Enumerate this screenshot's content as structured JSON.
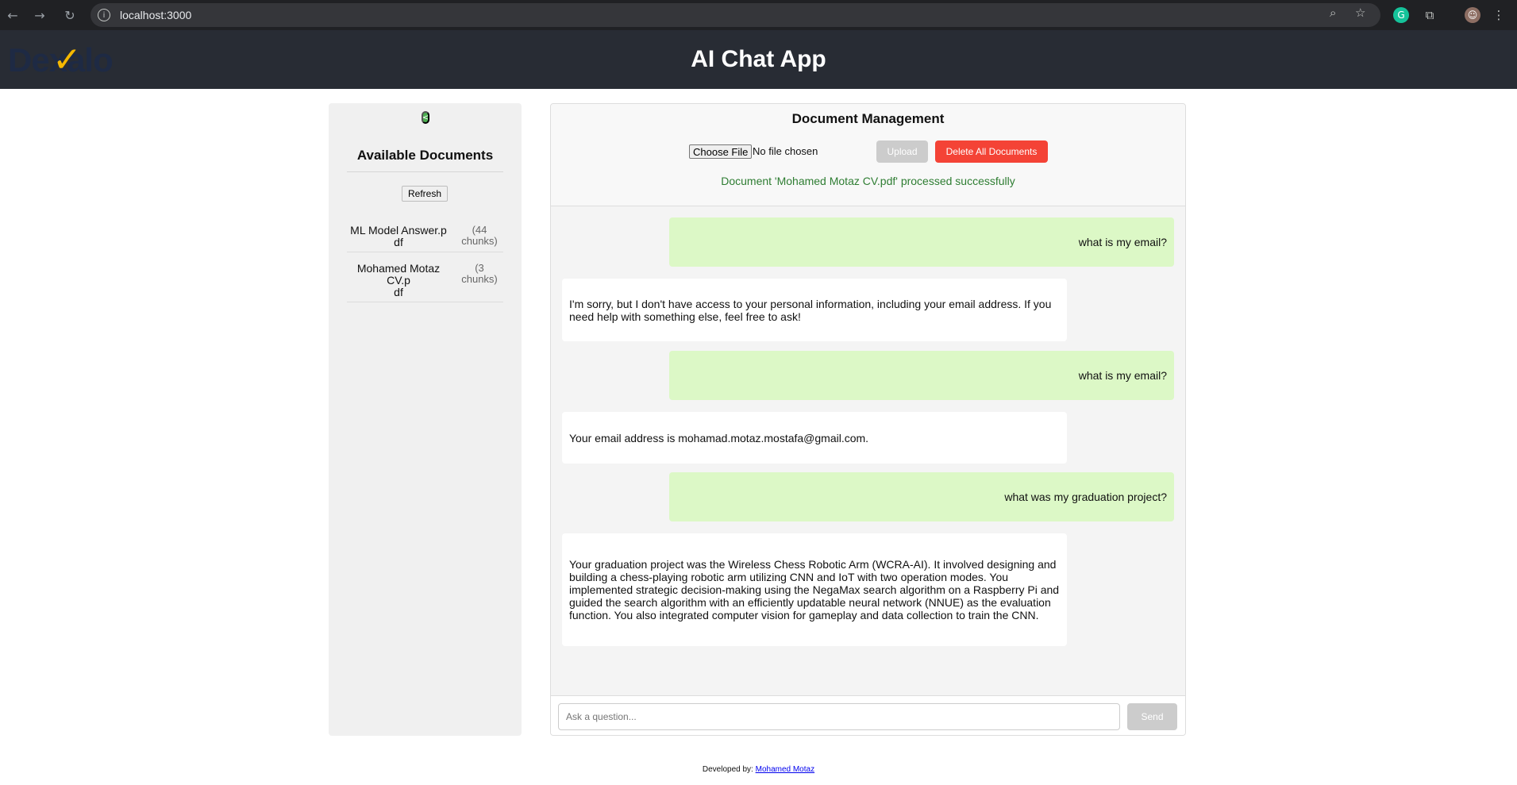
{
  "browser": {
    "url": "localhost:3000",
    "back_icon": "arrow-left-icon",
    "forward_icon": "arrow-right-icon",
    "reload_icon": "reload-icon"
  },
  "header": {
    "logo_text": "Dexalo",
    "title": "AI Chat App"
  },
  "sidebar": {
    "collapse_label": "<",
    "title": "Available Documents",
    "refresh_label": "Refresh",
    "documents": [
      {
        "name": "ML Model Answer.pdf",
        "name_line1": "ML Model Answer.p",
        "name_line2": "df",
        "chunks_line1": "(44",
        "chunks_line2": "chunks)"
      },
      {
        "name": "Mohamed Motaz CV.pdf",
        "name_line1": "Mohamed Motaz CV.p",
        "name_line2": "df",
        "chunks_line1": "(3",
        "chunks_line2": "chunks)"
      }
    ]
  },
  "doc_management": {
    "title": "Document Management",
    "choose_file_label": "Choose File",
    "no_file_text": "No file chosen",
    "upload_label": "Upload",
    "delete_all_label": "Delete All Documents",
    "status_message": "Document 'Mohamed Motaz CV.pdf' processed successfully"
  },
  "messages": [
    {
      "role": "user",
      "text": "what is my email?"
    },
    {
      "role": "bot",
      "text": "I'm sorry, but I don't have access to your personal information, including your email address. If you need help with something else, feel free to ask!"
    },
    {
      "role": "user",
      "text": "what is my email?"
    },
    {
      "role": "bot",
      "text": "Your email address is mohamad.motaz.mostafa@gmail.com."
    },
    {
      "role": "user",
      "text": "what was my graduation project?"
    },
    {
      "role": "bot",
      "text": "Your graduation project was the Wireless Chess Robotic Arm (WCRA-AI). It involved designing and building a chess-playing robotic arm utilizing CNN and IoT with two operation modes. You implemented strategic decision-making using the NegaMax search algorithm on a Raspberry Pi and guided the search algorithm with an efficiently updatable neural network (NNUE) as the evaluation function. You also integrated computer vision for gameplay and data collection to train the CNN."
    }
  ],
  "chat_input": {
    "placeholder": "Ask a question...",
    "send_label": "Send"
  },
  "footer": {
    "prefix": "Developed by:",
    "author": "Mohamed Motaz"
  },
  "colors": {
    "header_bg": "#282c34",
    "user_bubble": "#dcf8c6",
    "delete_button": "#f44336",
    "status_success": "#2e7d32",
    "collapse_button": "#4caf50"
  }
}
